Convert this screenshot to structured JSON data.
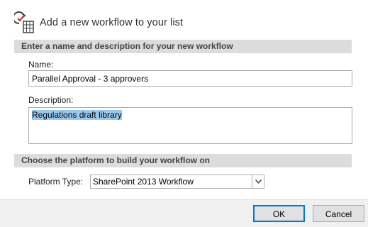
{
  "dialog": {
    "title": "Add a new workflow to your list",
    "icon": "workflow-list-icon"
  },
  "section_name": {
    "header": "Enter a name and description for your new workflow",
    "name_label": "Name:",
    "name_value": "Parallel Approval - 3 approvers",
    "description_label": "Description:",
    "description_value": "Regulations draft library"
  },
  "section_platform": {
    "header": "Choose the platform to build your workflow on",
    "platform_label": "Platform Type:",
    "platform_value": "SharePoint 2013 Workflow"
  },
  "buttons": {
    "ok": "OK",
    "cancel": "Cancel"
  },
  "colors": {
    "section_bar": "#dcdcdc",
    "selection": "#99c9ef",
    "default_button_border": "#0078d7"
  }
}
